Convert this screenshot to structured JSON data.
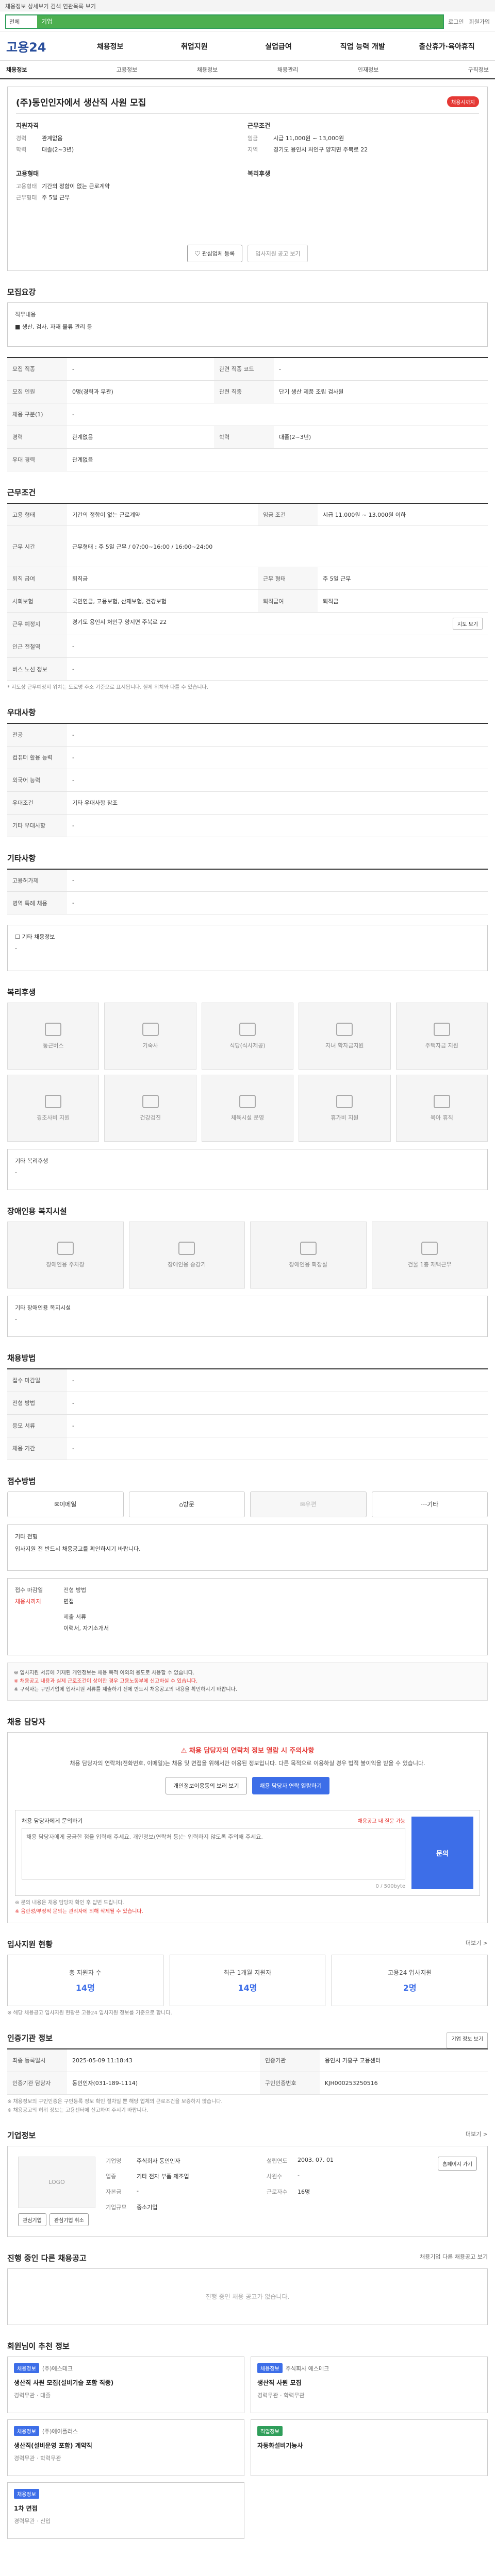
{
  "topbar": {
    "note": "채용정보 상세보기 검색 연관목록 보기"
  },
  "search": {
    "scope": "전체",
    "value": "기업",
    "links": [
      "로그인",
      "회원가입"
    ]
  },
  "gnb": {
    "logo": "고용24",
    "items": [
      "채용정보",
      "취업지원",
      "실업급여",
      "직업 능력 개발",
      "출산휴가·육아휴직"
    ]
  },
  "subnav": [
    "채용정보",
    "고용정보",
    "채용정보",
    "채용관리",
    "인재정보",
    "구직정보"
  ],
  "header": {
    "title": "(주)동인인자에서 생산직 사원 모집",
    "badge": "채용시까지",
    "col1_title": "지원자격",
    "col1": [
      {
        "k": "경력",
        "v": "관계없음"
      },
      {
        "k": "학력",
        "v": "대졸(2~3년)"
      }
    ],
    "col1b_title": "고용형태",
    "col1b": [
      {
        "k": "고용형태",
        "v": "기간의 정함이 없는 근로계약"
      },
      {
        "k": "근무형태",
        "v": "주 5일 근무"
      }
    ],
    "col2_title": "근무조건",
    "col2": [
      {
        "k": "임금",
        "v": "시급 11,000원 ~ 13,000원"
      },
      {
        "k": "지역",
        "v": "경기도 용인시 처인구 양지면 주북로 22"
      }
    ],
    "col2b_title": "복리후생",
    "actions": [
      "관심업체 등록",
      "입사지원 공고 보기"
    ]
  },
  "recruit": {
    "title": "모집요강",
    "job_label": "직무내용",
    "job_value": "■ 생산, 검사, 자재 물류 관리 등"
  },
  "overview_rows": [
    [
      "모집 직종",
      "-",
      "관련 직종 코드",
      "-"
    ],
    [
      "모집 인원",
      "0명(경력과 무관)",
      "관련 직종",
      "단기 생산 제품 조립 검사원"
    ],
    [
      "채용 구분(1)",
      "-",
      "",
      ""
    ],
    [
      "경력",
      "관계없음",
      "학력",
      "대졸(2~3년)"
    ],
    [
      "우대 경력",
      "관계없음",
      "",
      ""
    ]
  ],
  "work": {
    "title": "근무조건",
    "rows": [
      [
        "고용 형태",
        "기간의 정함이 없는 근로계약",
        "임금 조건",
        "시급 11,000원 ~ 13,000원 이하"
      ],
      [
        "근무 시간",
        "근무형태 : 주 5일 근무 / 07:00~16:00 / 16:00~24:00",
        "",
        ""
      ],
      [
        "퇴직 급여",
        "퇴직금",
        "근무 형태",
        "주 5일 근무"
      ],
      [
        "사회보험",
        "국민연금, 고용보험, 산재보험, 건강보험",
        "퇴직급여",
        "퇴직금"
      ],
      [
        "근무 예정지",
        "경기도 용인시 처인구 양지면 주북로 22",
        "",
        ""
      ],
      [
        "인근 전철역",
        "-",
        "",
        ""
      ],
      [
        "버스 노선 정보",
        "-",
        "",
        ""
      ]
    ],
    "map_btn": "지도 보기",
    "note": "* 지도상 근무예정지 위치는 도로명 주소 기준으로 표시됩니다. 실제 위치와 다를 수 있습니다."
  },
  "preference": {
    "title": "우대사항",
    "rows": [
      [
        "전공",
        "-"
      ],
      [
        "컴퓨터 활용 능력",
        "-"
      ],
      [
        "외국어 능력",
        "-"
      ],
      [
        "우대조건",
        "기타 우대사항 참조"
      ],
      [
        "기타 우대사항",
        "-"
      ]
    ]
  },
  "other": {
    "title": "기타사항",
    "rows": [
      [
        "고용허가제",
        "-"
      ],
      [
        "병역 특례 채용",
        "-"
      ]
    ],
    "extra_label": "기타 채용정보",
    "extra_value": "-"
  },
  "welfare": {
    "title": "복리후생",
    "tiles": [
      "통근버스",
      "기숙사",
      "식당(식사제공)",
      "자녀 학자금지원",
      "주택자금 지원",
      "경조사비 지원",
      "건강검진",
      "체육시설 운영",
      "휴가비 지원",
      "육아 휴직"
    ],
    "list_title": "기타 복리후생",
    "list_value": "-"
  },
  "disability": {
    "title": "장애인용 복지시설",
    "tiles": [
      "장애인용 주차장",
      "장애인용 승강기",
      "장애인용 화장실",
      "건물 1층 재택근무"
    ],
    "list_title": "기타 장애인용 복지시설",
    "list_value": "-"
  },
  "process": {
    "title": "채용방법",
    "rows": [
      [
        "접수 마감일",
        "-",
        "",
        ""
      ],
      [
        "전형 방법",
        "-",
        "",
        ""
      ],
      [
        "응모 서류",
        "-",
        "",
        ""
      ],
      [
        "채용 기간",
        "-",
        "",
        ""
      ]
    ]
  },
  "apply": {
    "title": "접수방법",
    "methods": [
      "이메일",
      "방문",
      "우편",
      "기타"
    ],
    "extra_label": "기타 전형",
    "extra_value": "입사지원 전 반드시 채용공고를 확인하시기 바랍니다.",
    "deadline_label": "접수 마감일",
    "deadline_value": "채용시까지",
    "screen_label": "전형 방법",
    "screen_value": "면접",
    "docs_label": "제출 서류",
    "docs_value": "이력서, 자기소개서"
  },
  "notices": [
    "※ 입사지원 서류에 기재된 개인정보는 채용 목적 이외의 용도로 사용할 수 없습니다.",
    "※ 채용공고 내용과 실제 근로조건이 상이한 경우 고용노동부에 신고하실 수 있습니다.",
    "※ 구직자는 구인기업에 입사지원 서류를 제출하기 전에 반드시 채용공고의 내용을 확인하시기 바랍니다."
  ],
  "contact": {
    "title": "채용 담당자",
    "warn_title": "채용 담당자의 연락처 정보 열람 시 주의사항",
    "warn_text": "채용 담당자의 연락처(전화번호, 이메일)는 채용 및 면접을 위해서만 이용된 정보입니다. 다른 목적으로 이용하실 경우 법적 불이익을 받을 수 있습니다.",
    "btn1": "개인정보이용동의 보러 보기",
    "btn2": "채용 담당자 연락 열람하기",
    "inq_label": "채용 담당자에게 문의하기",
    "inq_hint": "채용공고 내 질문 가능",
    "inq_placeholder": "채용 담당자에게 궁금한 점을 입력해 주세요. 개인정보(연락처 등)는 입력하지 않도록 주의해 주세요.",
    "inq_counter": "0 / 500byte",
    "inq_submit": "문의",
    "inq_note1": "※ 문의 내용은 채용 담당자 확인 후 답변 드립니다.",
    "inq_note2": "※ 음란성/부정적 문의는 관리자에 의해 삭제될 수 있습니다."
  },
  "stats": {
    "title": "입사지원 현황",
    "more": "더보기 >",
    "items": [
      {
        "label": "총 지원자 수",
        "value": "14명"
      },
      {
        "label": "최근 1개월 지원자",
        "value": "14명"
      },
      {
        "label": "고용24 입사지원",
        "value": "2명"
      }
    ],
    "note": "※ 해당 채용공고 입사지원 현황은 고용24 입사지원 정보를 기준으로 합니다."
  },
  "info": {
    "title": "인증기관 정보",
    "more": "기업 정보 보기",
    "rows": [
      [
        "최종 등록일시",
        "2025-05-09 11:18:43",
        "인증기관",
        "용인시 기흥구 고용센터"
      ],
      [
        "인증기관 담당자",
        "동인인자(031-189-1114)",
        "구인인증번호",
        "KJH000253250516"
      ]
    ],
    "notes": [
      "※ 채용정보의 구인인증은 구인등록 정보 확인 절차일 뿐 해당 업체의 근로조건을 보증하지 않습니다.",
      "※ 채용공고의 허위 정보는 고용센터에 신고하여 주시기 바랍니다."
    ]
  },
  "company": {
    "title": "기업정보",
    "more": "더보기 >",
    "logo_placeholder": "LOGO",
    "rows": [
      [
        "기업명",
        "주식회사 동인인자",
        "설립연도",
        "2003. 07. 01"
      ],
      [
        "업종",
        "기타 전자 부품 제조업",
        "사원수",
        "-"
      ],
      [
        "자본금",
        "-",
        "근로자수",
        "16명"
      ],
      [
        "기업규모",
        "중소기업",
        "",
        ""
      ]
    ],
    "homepage_btn": "홈페이지 가기",
    "btns": [
      "관심기업",
      "관심기업 취소"
    ]
  },
  "same_company": {
    "title": "진행 중인 다른 채용공고",
    "more": "채용기업 다른 채용공고 보기",
    "empty": "진행 중인 채용 공고가 없습니다."
  },
  "recommend": {
    "title": "회원님이 추천 정보",
    "cards": [
      {
        "chip": "채용정보",
        "org": "(주)에스테크",
        "title": "생산직 사원 모집(설비기술 포함 직종)",
        "meta": "경력무관 · 대졸"
      },
      {
        "chip": "채용정보",
        "org": "주식회사 에스테크",
        "title": "생산직 사원 모집",
        "meta": "경력무관 · 학력무관"
      },
      {
        "chip": "채용정보",
        "org": "(주)에이플러스",
        "title": "생산직(설비운영 포함) 계약직",
        "meta": "경력무관 · 학력무관"
      },
      {
        "chip": "직업정보",
        "org": "",
        "title": "자동화설비기능사",
        "meta": ""
      },
      {
        "chip": "채용정보",
        "org": "",
        "title": "1차 면접",
        "meta": "경력무관 · 신입"
      }
    ]
  }
}
